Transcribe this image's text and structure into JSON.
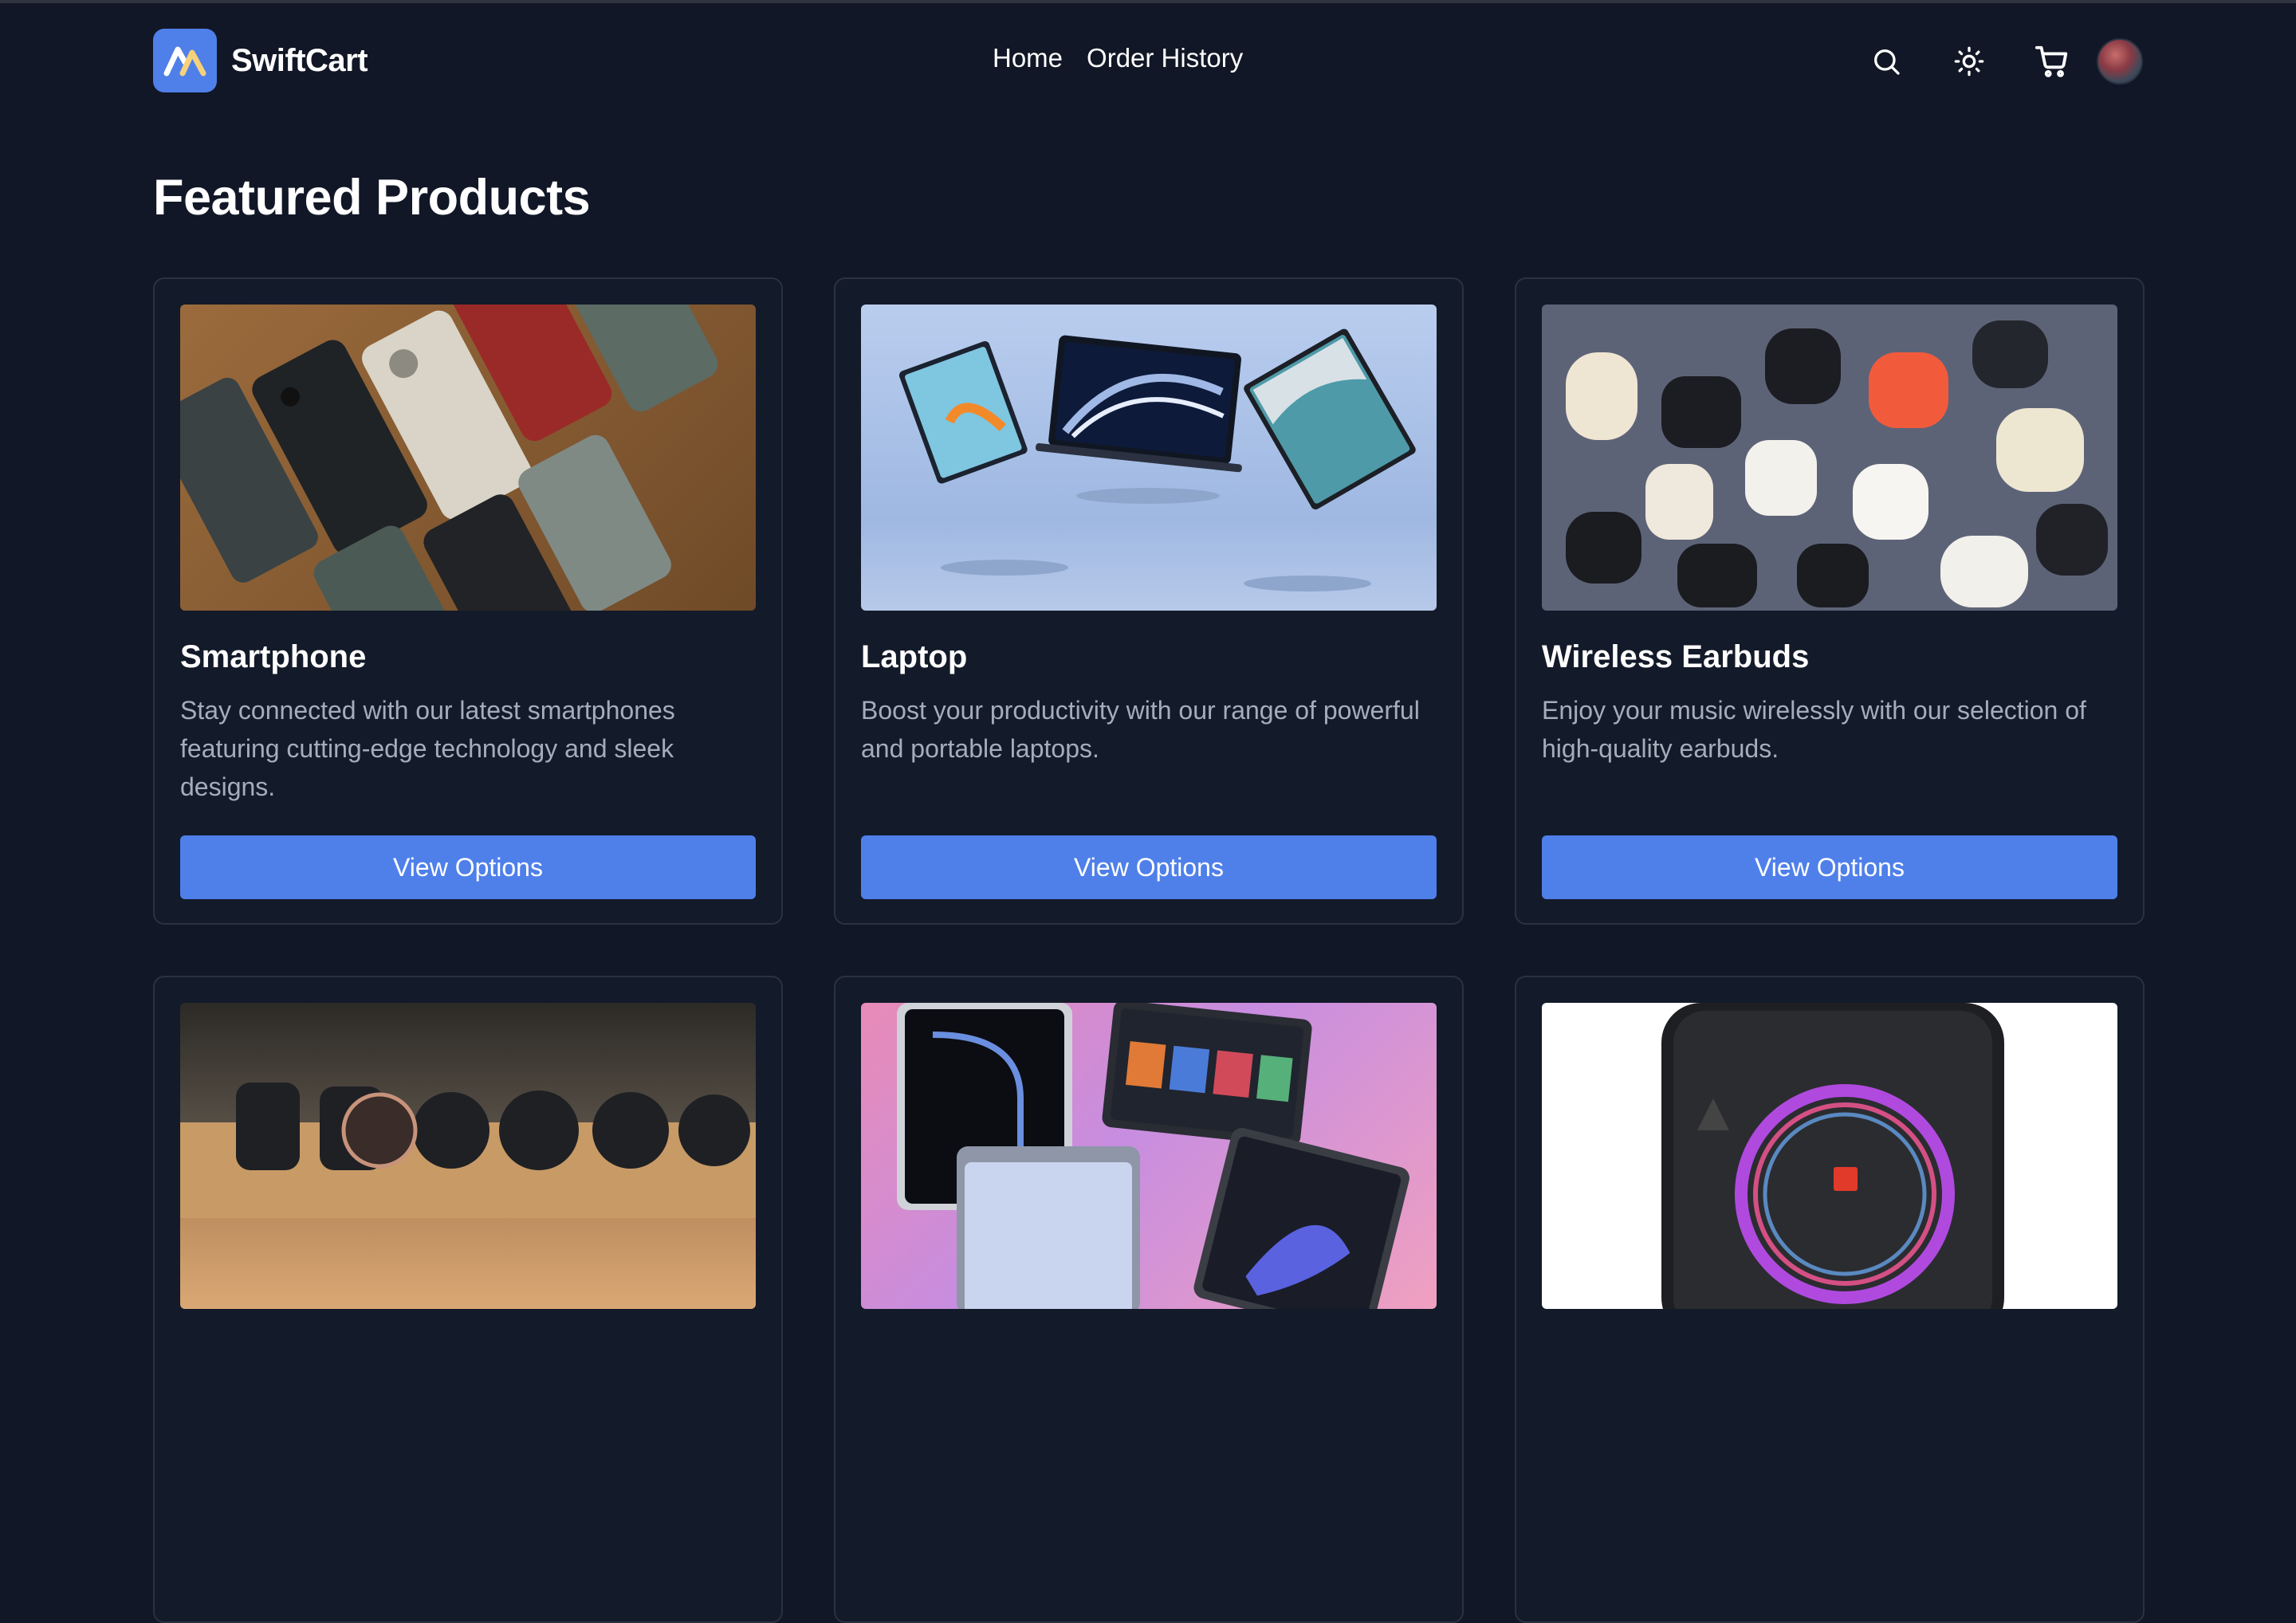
{
  "brand": {
    "name": "SwiftCart",
    "logo_icon": "swiftcart-logo-icon",
    "accent": "#4f80ea",
    "background": "#111726"
  },
  "nav": {
    "links": [
      {
        "label": "Home"
      },
      {
        "label": "Order History"
      }
    ]
  },
  "header_actions": {
    "search_icon": "search-icon",
    "theme_icon": "sun-icon",
    "cart_icon": "cart-icon",
    "avatar": "user-avatar"
  },
  "page": {
    "title": "Featured Products"
  },
  "products": [
    {
      "name": "Smartphone",
      "description": "Stay connected with our latest smartphones featuring cutting-edge technology and sleek designs.",
      "button_label": "View Options",
      "image": "smartphones-photo"
    },
    {
      "name": "Laptop",
      "description": "Boost your productivity with our range of powerful and portable laptops.",
      "button_label": "View Options",
      "image": "laptops-photo"
    },
    {
      "name": "Wireless Earbuds",
      "description": "Enjoy your music wirelessly with our selection of high-quality earbuds.",
      "button_label": "View Options",
      "image": "earbuds-photo"
    },
    {
      "name": "",
      "description": "",
      "button_label": "",
      "image": "smartwatches-photo"
    },
    {
      "name": "",
      "description": "",
      "button_label": "",
      "image": "tablets-photo"
    },
    {
      "name": "",
      "description": "",
      "button_label": "",
      "image": "speaker-photo"
    }
  ]
}
